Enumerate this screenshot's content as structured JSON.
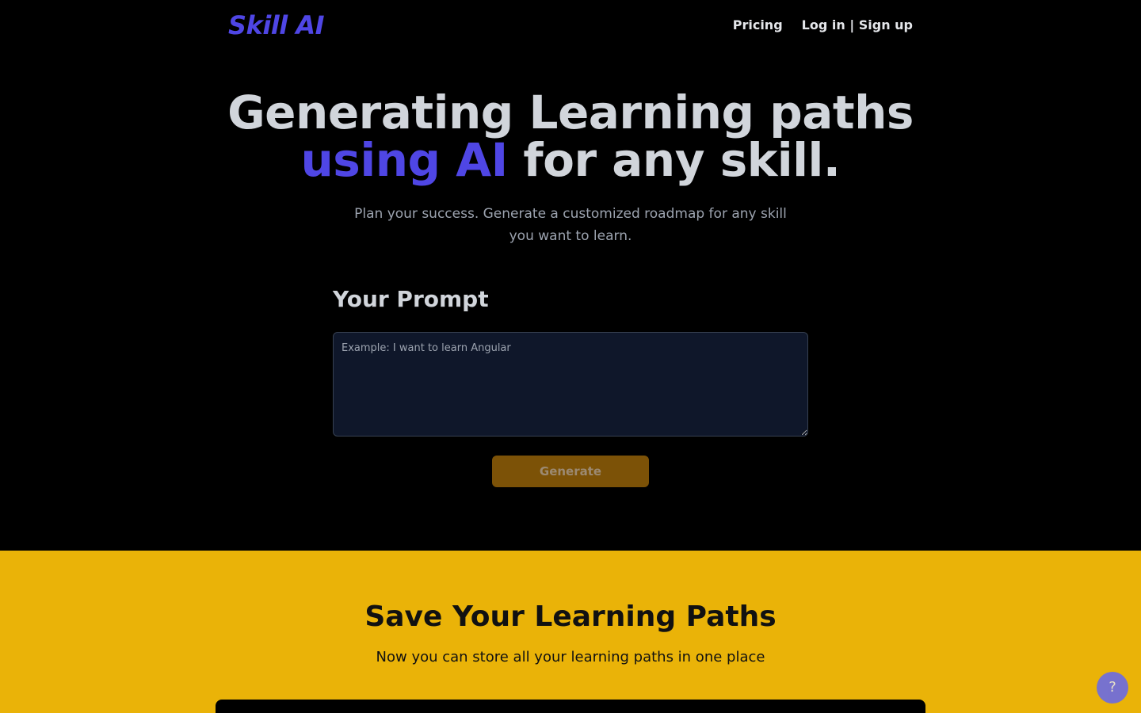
{
  "nav": {
    "logo": "Skill AI",
    "pricing": "Pricing",
    "auth": "Log in | Sign up"
  },
  "hero": {
    "title_line1": "Generating Learning paths",
    "title_accent": "using AI",
    "title_rest": "for any skill.",
    "subtitle": "Plan your success. Generate a customized roadmap for any skill you want to learn."
  },
  "prompt": {
    "label": "Your Prompt",
    "placeholder": "Example: I want to learn Angular",
    "value": "",
    "button": "Generate"
  },
  "save": {
    "title": "Save Your Learning Paths",
    "subtitle": "Now you can store all your learning paths in one place"
  },
  "help": {
    "label": "?",
    "icon": "question-icon"
  },
  "colors": {
    "accent": "#4f46e5",
    "background": "#000000",
    "section_yellow": "#eab308",
    "button": "#7c5207"
  }
}
